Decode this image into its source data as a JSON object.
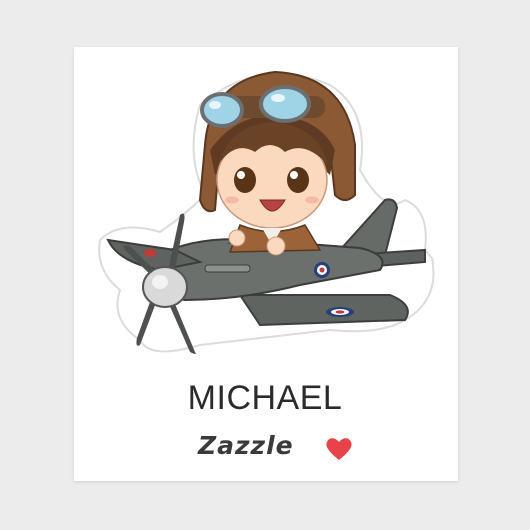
{
  "sticker": {
    "name": "MICHAEL",
    "brand": "Zazzle"
  },
  "icons": {
    "heart": "heart-icon"
  },
  "colors": {
    "background": "#ececec",
    "sheet": "#ffffff",
    "text": "#2b2b2b",
    "heart": "#e8424b",
    "helmet": "#8b5a34",
    "plane": "#5b5f5c",
    "roundel_red": "#c23a3a",
    "roundel_blue": "#24407a"
  }
}
